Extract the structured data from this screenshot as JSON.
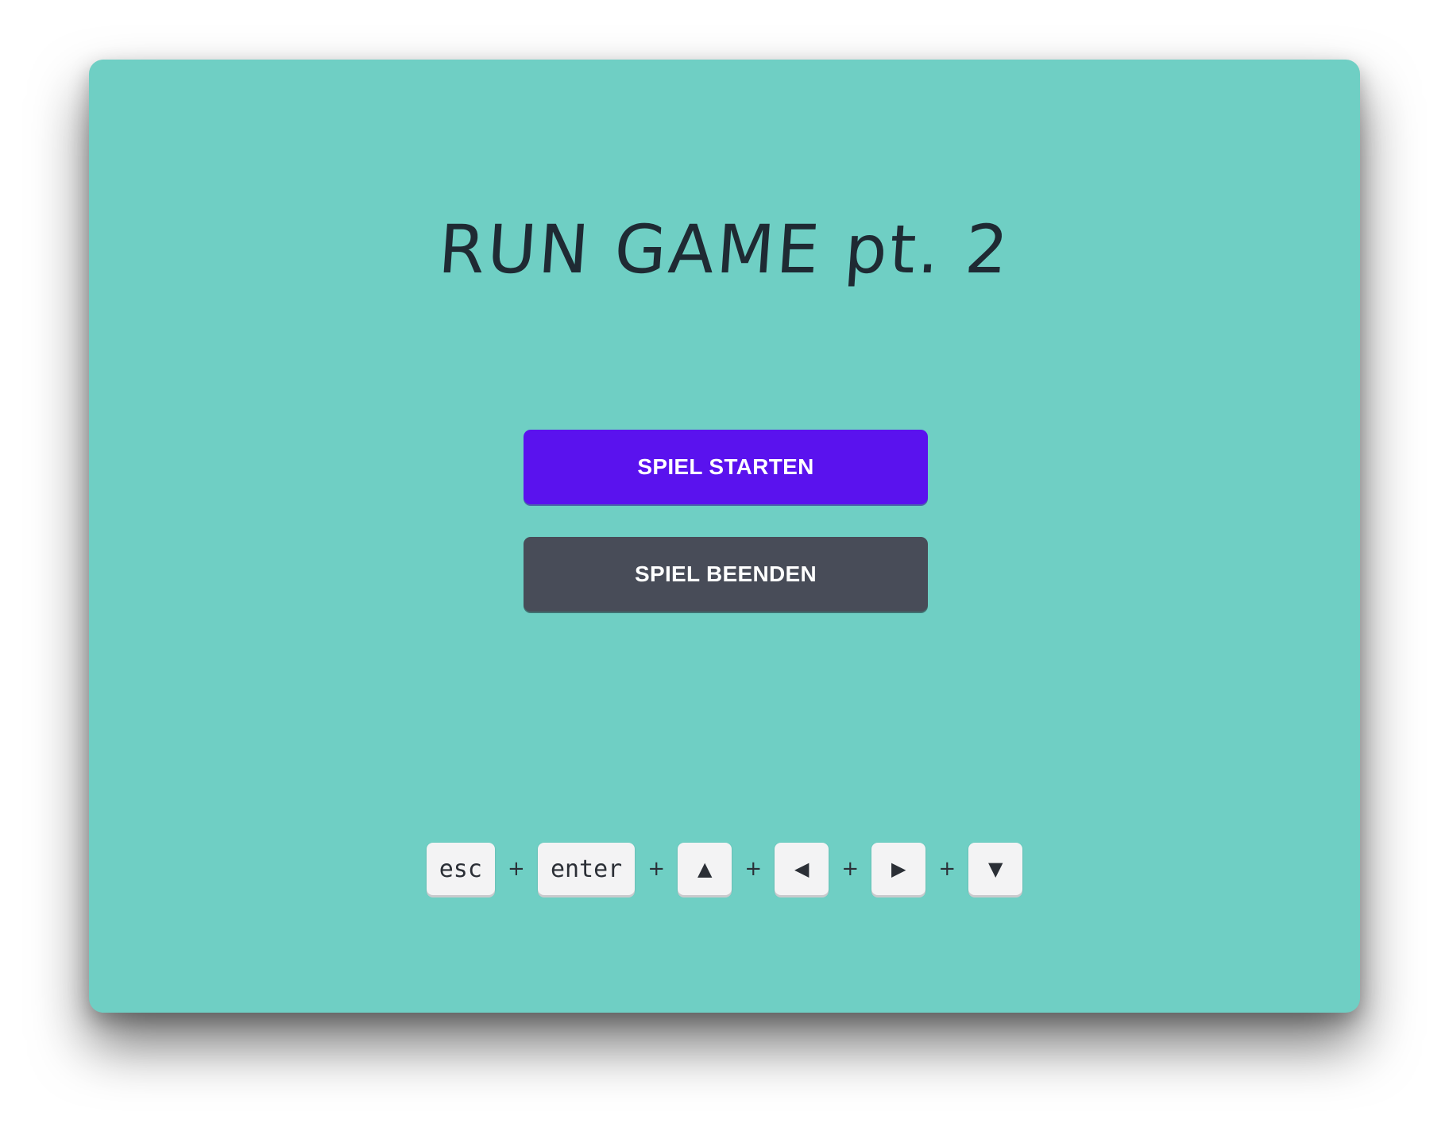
{
  "title": "RUN GAME pt. 2",
  "menu": {
    "start_label": "SPIEL STARTEN",
    "quit_label": "SPIEL BEENDEN"
  },
  "controls": {
    "keys": [
      "esc",
      "enter",
      "▲",
      "◀",
      "▶",
      "▼"
    ],
    "separator": "+"
  },
  "colors": {
    "background": "#6fcfc4",
    "start_button": "#5a12ee",
    "quit_button": "#484c58",
    "key": "#f3f3f4",
    "text_dark": "#1f2a33"
  }
}
